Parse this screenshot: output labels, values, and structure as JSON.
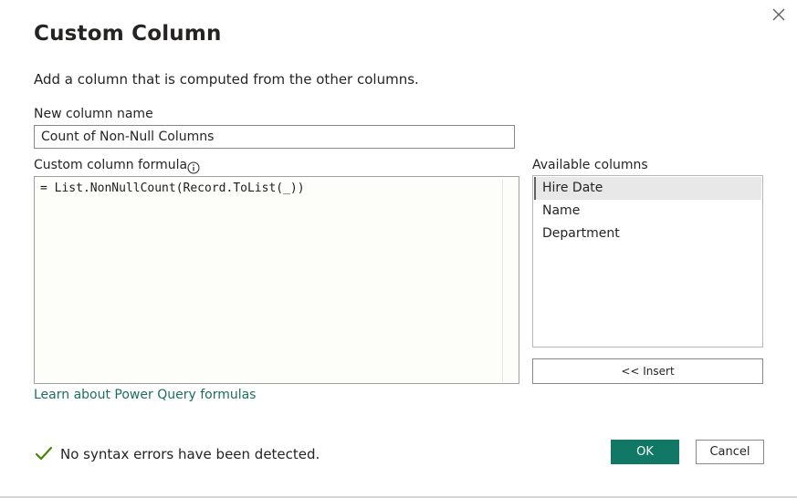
{
  "dialog": {
    "title": "Custom Column",
    "subtitle": "Add a column that is computed from the other columns.",
    "close_icon": "close-icon"
  },
  "new_column": {
    "label": "New column name",
    "value": "Count of Non-Null Columns"
  },
  "formula": {
    "label": "Custom column formula",
    "info_icon": "info-icon",
    "value": "= List.NonNullCount(Record.ToList(_))"
  },
  "available_columns": {
    "label": "Available columns",
    "items": [
      {
        "label": "Hire Date",
        "selected": true
      },
      {
        "label": "Name",
        "selected": false
      },
      {
        "label": "Department",
        "selected": false
      }
    ],
    "insert_label": "<< Insert"
  },
  "learn_link": "Learn about Power Query formulas",
  "status": {
    "icon": "checkmark-icon",
    "text": "No syntax errors have been detected.",
    "color": "#498205"
  },
  "buttons": {
    "ok_label": "OK",
    "cancel_label": "Cancel",
    "accent": "#117865"
  }
}
